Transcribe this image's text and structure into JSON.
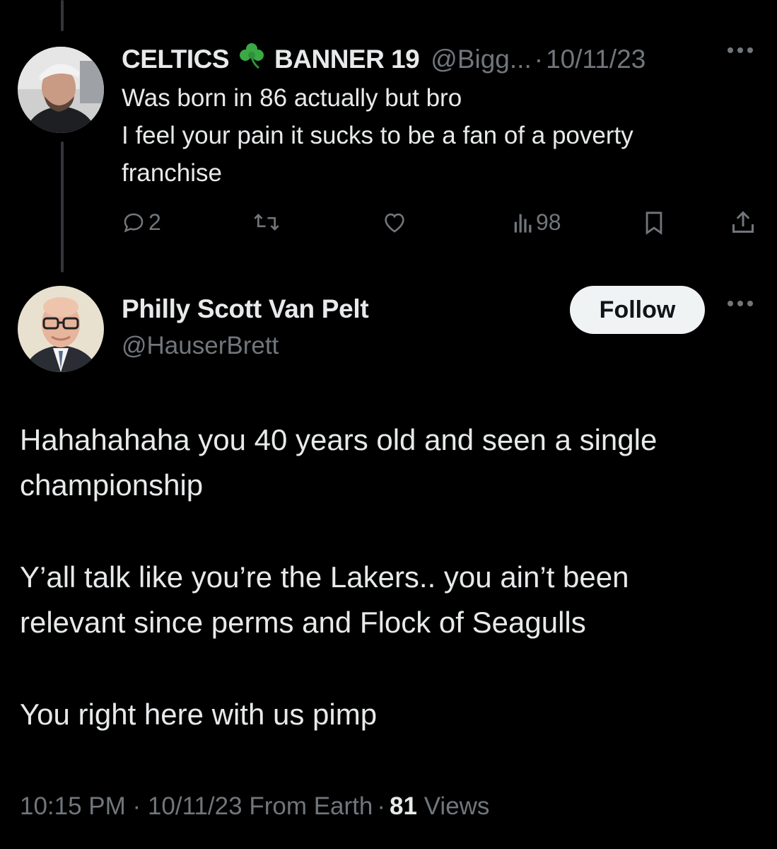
{
  "reply": {
    "display_name_part1": "CELTICS",
    "clover_icon": "shamrock-emoji",
    "display_name_part2": "BANNER 19",
    "handle": "@Bigg...",
    "separator": "·",
    "date": "10/11/23",
    "more_icon": "ellipsis-icon",
    "text_lines": [
      "Was born in 86 actually but bro",
      "I feel your pain it sucks to be a fan of a poverty",
      "franchise"
    ],
    "actions": {
      "replies": "2",
      "reposts": "",
      "likes": "",
      "views": "98"
    }
  },
  "main": {
    "display_name": "Philly Scott Van Pelt",
    "handle": "@HauserBrett",
    "follow_label": "Follow",
    "paragraphs": [
      [
        "Hahahahaha you 40 years old and seen a single",
        "championship"
      ],
      [
        "Y’all talk like you’re the Lakers.. you ain’t been",
        "relevant since perms and Flock of Seagulls"
      ],
      [
        "You right here with us pimp"
      ]
    ],
    "meta": {
      "time": "10:15 PM",
      "separator": "·",
      "date": "10/11/23",
      "source": "From Earth",
      "views_count": "81",
      "views_label": "Views"
    }
  },
  "colors": {
    "background": "#000000",
    "text": "#e7e9ea",
    "muted": "#71767b",
    "thread_line": "#333639",
    "follow_bg": "#eff3f4"
  }
}
